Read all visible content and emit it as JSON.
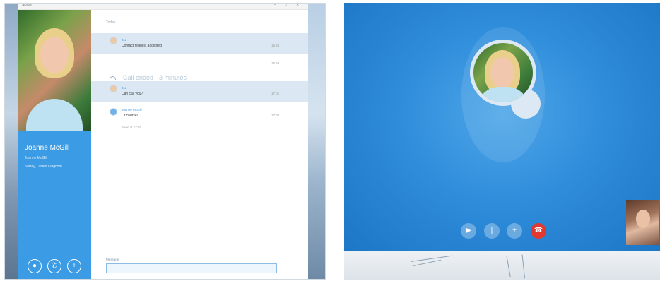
{
  "left_window": {
    "title": "Skype",
    "controls": [
      "–",
      "□",
      "✕"
    ],
    "profile": {
      "name": "Joanne McGill",
      "status": "Joanne McGill",
      "location": "Surrey, United Kingdom",
      "actions": [
        "video-call",
        "audio-call",
        "add"
      ]
    },
    "chat": {
      "date_label": "Today",
      "messages": [
        {
          "sender": "Joe",
          "text": "Contact request accepted",
          "time": "16:58",
          "selected": true
        },
        {
          "type": "call",
          "text": "Call ended · 3 minutes",
          "time": "16:59"
        },
        {
          "sender": "Joe",
          "text": "Can call you?",
          "time": "17:01",
          "selected": true
        },
        {
          "sender": "Joanne McGill",
          "text": "Of course!",
          "time": "17:02",
          "read_receipt": "Seen at 17:02"
        }
      ],
      "input_label": "Message",
      "input_value": ""
    }
  },
  "right_window": {
    "call_buttons": [
      "video-toggle",
      "mute",
      "add-people",
      "hang-up"
    ],
    "colors": {
      "call_blue": "#2f8ddb",
      "hangup_red": "#e2382e"
    }
  }
}
